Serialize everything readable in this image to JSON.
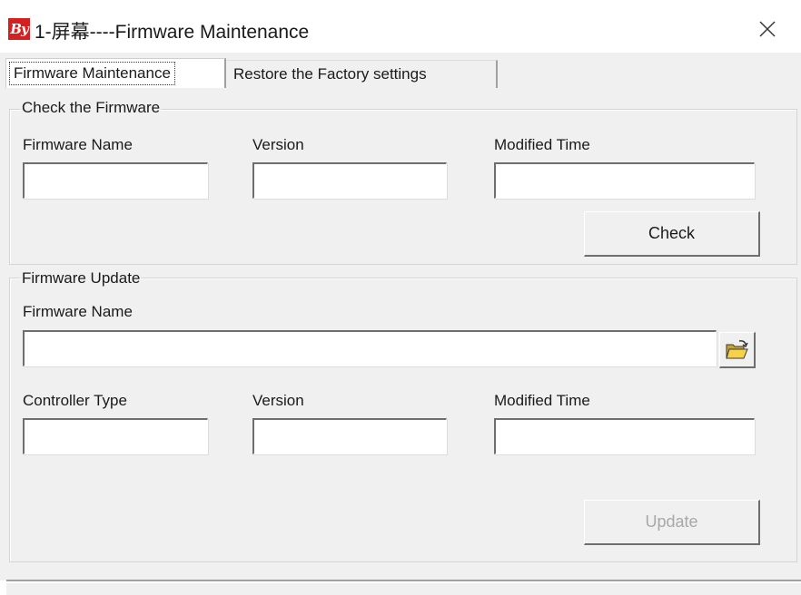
{
  "window": {
    "title": "1-屏幕----Firmware Maintenance",
    "icon_text": "By",
    "icon_color": "#d42020"
  },
  "tabs": [
    {
      "label": "Firmware Maintenance",
      "selected": true
    },
    {
      "label": "Restore the Factory settings",
      "selected": false
    }
  ],
  "check_group": {
    "legend": "Check the Firmware",
    "firmware_name_label": "Firmware Name",
    "version_label": "Version",
    "modified_time_label": "Modified Time",
    "firmware_name_value": "",
    "version_value": "",
    "modified_time_value": "",
    "check_button": "Check"
  },
  "update_group": {
    "legend": "Firmware Update",
    "firmware_name_label": "Firmware Name",
    "firmware_path_value": "",
    "browse_icon": "open-folder-icon",
    "controller_type_label": "Controller Type",
    "version_label": "Version",
    "modified_time_label": "Modified Time",
    "controller_type_value": "",
    "version_value": "",
    "modified_time_value": "",
    "update_button": "Update",
    "update_enabled": false
  }
}
